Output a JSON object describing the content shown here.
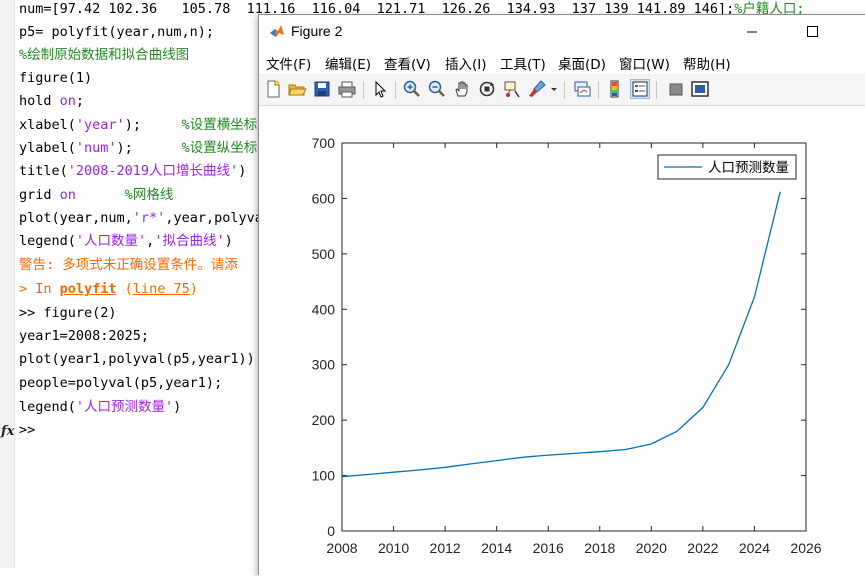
{
  "command_window": {
    "lines": [
      [
        {
          "t": "num=[97.42 102.36   105.78  111.16  116.04  121.71  126.26  134.93  137 139 141.89 146];",
          "c": ""
        },
        {
          "t": "%户籍人口;",
          "c": "c"
        }
      ],
      [
        {
          "t": "p5= polyfit(year,num,n);",
          "c": ""
        }
      ],
      [
        {
          "t": "%绘制原始数据和拟合曲线图",
          "c": "c"
        }
      ],
      [
        {
          "t": "figure(1)",
          "c": ""
        }
      ],
      [
        {
          "t": "hold ",
          "c": ""
        },
        {
          "t": "on",
          "c": "s"
        },
        {
          "t": ";",
          "c": ""
        }
      ],
      [
        {
          "t": "xlabel(",
          "c": ""
        },
        {
          "t": "'year'",
          "c": "s"
        },
        {
          "t": ");     ",
          "c": ""
        },
        {
          "t": "%设置横坐标",
          "c": "c"
        }
      ],
      [
        {
          "t": "ylabel(",
          "c": ""
        },
        {
          "t": "'num'",
          "c": "s"
        },
        {
          "t": ");      ",
          "c": ""
        },
        {
          "t": "%设置纵坐标",
          "c": "c"
        }
      ],
      [
        {
          "t": "title(",
          "c": ""
        },
        {
          "t": "'2008-2019人口增长曲线'",
          "c": "s"
        },
        {
          "t": ")",
          "c": ""
        }
      ],
      [
        {
          "t": "grid ",
          "c": ""
        },
        {
          "t": "on",
          "c": "s"
        },
        {
          "t": "      ",
          "c": ""
        },
        {
          "t": "%网格线",
          "c": "c"
        }
      ],
      [
        {
          "t": "plot(year,num,",
          "c": ""
        },
        {
          "t": "'r*'",
          "c": "s"
        },
        {
          "t": ",year,polyval",
          "c": ""
        }
      ],
      [
        {
          "t": "legend(",
          "c": ""
        },
        {
          "t": "'人口数量'",
          "c": "s"
        },
        {
          "t": ",",
          "c": ""
        },
        {
          "t": "'拟合曲线'",
          "c": "s"
        },
        {
          "t": ")",
          "c": ""
        }
      ],
      [
        {
          "t": "警告: 多项式未正确设置条件。请添",
          "c": "w"
        }
      ],
      [
        {
          "t": "> In ",
          "c": "w"
        },
        {
          "t": "polyfit",
          "c": "wl"
        },
        {
          "t": " (",
          "c": "w"
        },
        {
          "t": "line 75",
          "c": "wu"
        },
        {
          "t": ")",
          "c": "w"
        }
      ],
      [
        {
          "t": ">> figure(2)",
          "c": ""
        }
      ],
      [
        {
          "t": "year1=2008:2025;",
          "c": ""
        }
      ],
      [
        {
          "t": "plot(year1,polyval(p5,year1))",
          "c": ""
        }
      ],
      [
        {
          "t": "people=polyval(p5,year1);",
          "c": ""
        }
      ],
      [
        {
          "t": "legend(",
          "c": ""
        },
        {
          "t": "'人口预测数量'",
          "c": "s"
        },
        {
          "t": ")",
          "c": ""
        }
      ],
      [
        {
          "t": ">>",
          "c": ""
        }
      ]
    ],
    "fx_label": "fx"
  },
  "figure_window": {
    "title": "Figure 2",
    "menu": [
      "文件(F)",
      "编辑(E)",
      "查看(V)",
      "插入(I)",
      "工具(T)",
      "桌面(D)",
      "窗口(W)",
      "帮助(H)"
    ],
    "toolbar_icons": [
      "new-figure-icon",
      "open-file-icon",
      "save-icon",
      "print-icon",
      "pointer-icon",
      "zoom-in-icon",
      "zoom-out-icon",
      "pan-hand-icon",
      "rotate-3d-icon",
      "data-cursor-icon",
      "brush-icon",
      "dropdown-arrow-icon",
      "link-plot-icon",
      "colorbar-icon",
      "legend-icon",
      "hide-plot-tools-icon",
      "show-plot-tools-icon"
    ]
  },
  "chart_data": {
    "type": "line",
    "title": "",
    "xlabel": "",
    "ylabel": "",
    "xlim": [
      2008,
      2026
    ],
    "ylim": [
      0,
      700
    ],
    "xticks": [
      2008,
      2010,
      2012,
      2014,
      2016,
      2018,
      2020,
      2022,
      2024,
      2026
    ],
    "yticks": [
      0,
      100,
      200,
      300,
      400,
      500,
      600,
      700
    ],
    "grid": false,
    "legend_position": "top-right",
    "series": [
      {
        "name": "人口预测数量",
        "color": "#0072bd",
        "x": [
          2008,
          2009,
          2010,
          2011,
          2012,
          2013,
          2014,
          2015,
          2016,
          2017,
          2018,
          2019,
          2020,
          2021,
          2022,
          2023,
          2024,
          2025
        ],
        "values": [
          98,
          102,
          106,
          110,
          115,
          121,
          127,
          133,
          137,
          140,
          143,
          147,
          157,
          180,
          223,
          300,
          422,
          612
        ]
      }
    ]
  }
}
